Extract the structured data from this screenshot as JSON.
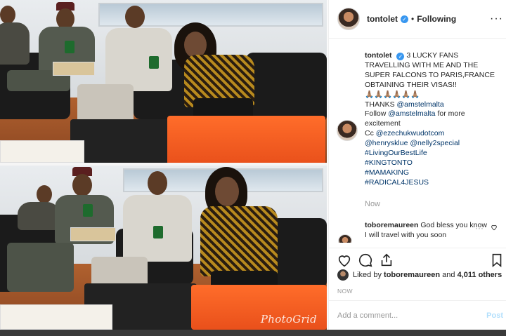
{
  "post": {
    "header": {
      "username": "tontolet",
      "verified_icon": "verified-badge-icon",
      "separator": "•",
      "follow_status": "Following",
      "more_icon": "more-options-icon",
      "more_glyph": "···"
    },
    "caption": {
      "username": "tontolet",
      "lines": [
        "3 LUCKY FANS",
        "TRAVELLING WITH ME AND THE",
        "SUPER FALCONS TO PARIS,FRANCE",
        "OBTAINING THEIR VISAS!!",
        "🙏🏽🙏🏽🙏🏽🙏🏽🙏🏽🙏🏽",
        "THANKS",
        "Follow",
        "for more",
        "excitement",
        "Cc"
      ],
      "mention_amstel_1": "@amstelmalta",
      "mention_amstel_2": "@amstelmalta",
      "mention_ezechukwu": "@ezechukwudotcom",
      "mention_henry": "@henrysklue",
      "mention_nelly": "@nelly2special",
      "hashtags": [
        "#LivingOurBestLife",
        "#KINGTONTO",
        "#MAMAKING",
        "#RADICAL4JESUS"
      ],
      "timestamp": "Now"
    },
    "comment": {
      "username": "toboremaureen",
      "text": "God bless you",
      "text2": "know I will travel with you soon",
      "more": "···"
    },
    "actions": {
      "like_icon": "heart-icon",
      "comment_icon": "comment-bubble-icon",
      "share_icon": "share-icon",
      "save_icon": "bookmark-icon"
    },
    "likes": {
      "prefix": "Liked by",
      "user": "toboremaureen",
      "connector": "and",
      "count": "4,011 others"
    },
    "post_time": "NOW",
    "add_comment": {
      "placeholder": "Add a comment...",
      "post_label": "Post"
    },
    "photo": {
      "watermark": "PhotoGrid"
    }
  },
  "colors": {
    "accent_blue": "#3897f0",
    "link": "#003569",
    "muted": "#999999",
    "folder_orange": "#ff6d2a"
  }
}
